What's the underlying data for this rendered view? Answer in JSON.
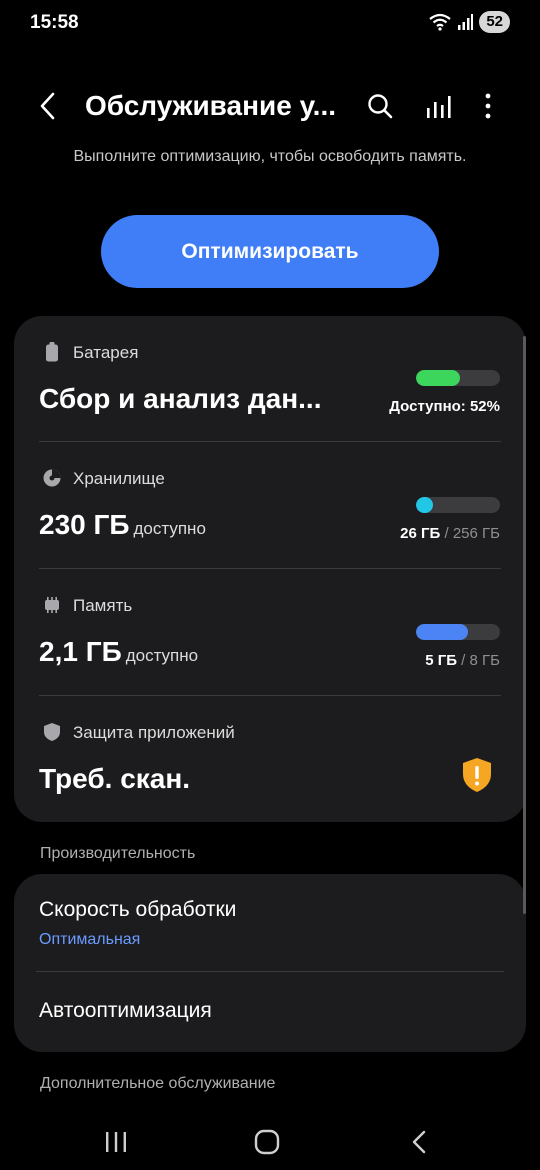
{
  "status_bar": {
    "time": "15:58",
    "battery": "52"
  },
  "header": {
    "title": "Обслуживание у..."
  },
  "intro": {
    "subtitle": "Выполните оптимизацию, чтобы освободить память.",
    "optimize_label": "Оптимизировать"
  },
  "battery": {
    "label": "Батарея",
    "value": "Сбор и анализ дан...",
    "caption": "Доступно: 52%",
    "level_percent": 52,
    "color": "#3dd65c"
  },
  "storage": {
    "label": "Хранилище",
    "value": "230 ГБ",
    "unit": "доступно",
    "used": "26 ГБ",
    "separator": "/",
    "total": "256 ГБ",
    "used_fraction": 0.1,
    "color": "#22c7e6"
  },
  "memory": {
    "label": "Память",
    "value": "2,1 ГБ",
    "unit": "доступно",
    "used": "5 ГБ",
    "separator": "/",
    "total": "8 ГБ",
    "used_fraction": 0.62,
    "color": "#4d84f5"
  },
  "app_protection": {
    "label": "Защита приложений",
    "value": "Треб. скан.",
    "warning_color": "#f5a623"
  },
  "performance": {
    "section_title": "Производительность",
    "speed_title": "Скорость обработки",
    "speed_value": "Оптимальная",
    "auto_title": "Автооптимизация"
  },
  "extra": {
    "section_title": "Дополнительное обслуживание"
  },
  "icons": [
    "back-icon",
    "search-icon",
    "bar-chart-icon",
    "more-vert-icon",
    "battery-icon",
    "storage-pie-icon",
    "memory-chip-icon",
    "shield-icon",
    "warning-shield-icon",
    "recent-apps-icon",
    "home-icon",
    "nav-back-icon"
  ]
}
